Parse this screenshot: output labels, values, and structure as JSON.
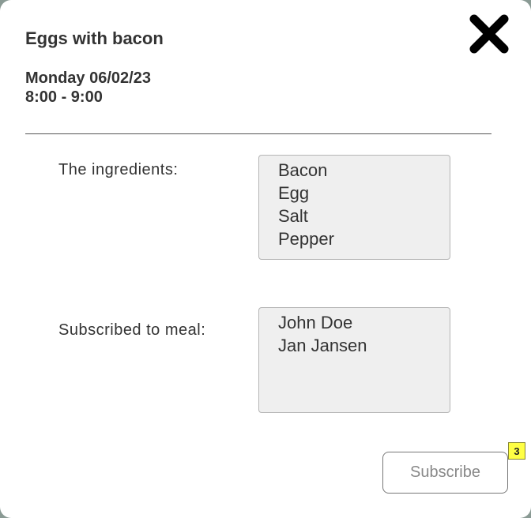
{
  "dialog": {
    "title": "Eggs with bacon",
    "date": "Monday 06/02/23",
    "time": "8:00 - 9:00",
    "close_icon": "close-x-icon"
  },
  "ingredients": {
    "label": "The ingredients:",
    "items": [
      "Bacon",
      "Egg",
      "Salt",
      "Pepper"
    ]
  },
  "subscribers": {
    "label": "Subscribed to meal:",
    "items": [
      "John Doe",
      "Jan Jansen"
    ]
  },
  "actions": {
    "subscribe_label": "Subscribe",
    "badge": "3"
  },
  "colors": {
    "text": "#333333",
    "listbox_bg": "#efefef",
    "badge_bg": "#ffff44"
  }
}
